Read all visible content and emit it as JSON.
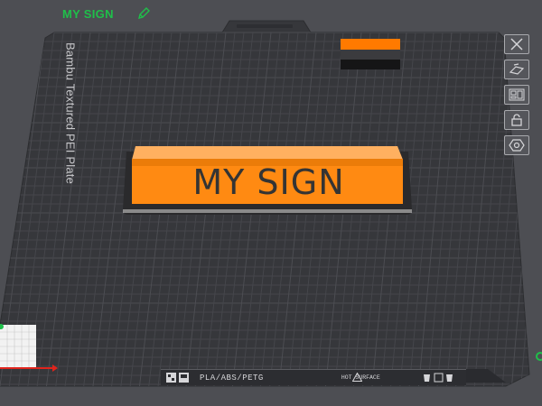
{
  "plate": {
    "name": "MY SIGN",
    "bed_label": "Bambu Textured PEI Plate"
  },
  "model": {
    "text": "MY SIGN",
    "base_color": "#2a2a2c",
    "face_color": "#ff8a12"
  },
  "toolbar": {
    "items": [
      {
        "name": "close-icon"
      },
      {
        "name": "auto-orient-icon"
      },
      {
        "name": "arrange-icon"
      },
      {
        "name": "lock-icon"
      },
      {
        "name": "settings-icon"
      }
    ]
  },
  "bottom_bar": {
    "material": "PLA/ABS/PETG",
    "hot_surface": "HOT SURFACE"
  },
  "colors": {
    "accent_green": "#1fbf4a",
    "background": "#4d4e53",
    "bed": "#36373b",
    "grid": "#46474c"
  }
}
